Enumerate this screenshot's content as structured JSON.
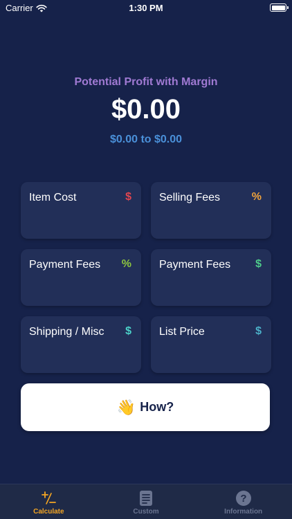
{
  "status_bar": {
    "carrier": "Carrier",
    "time": "1:30 PM"
  },
  "header": {
    "label": "Potential Profit with Margin",
    "value": "$0.00",
    "range": "$0.00 to $0.00"
  },
  "cards": [
    {
      "label": "Item Cost",
      "unit": "$",
      "unit_color": "#e0454f"
    },
    {
      "label": "Selling Fees",
      "unit": "%",
      "unit_color": "#f0a33c"
    },
    {
      "label": "Payment Fees",
      "unit": "%",
      "unit_color": "#8dc63f"
    },
    {
      "label": "Payment Fees",
      "unit": "$",
      "unit_color": "#4ecb8a"
    },
    {
      "label": "Shipping / Misc",
      "unit": "$",
      "unit_color": "#4bd1c8"
    },
    {
      "label": "List Price",
      "unit": "$",
      "unit_color": "#4bb0c8"
    }
  ],
  "how_button": {
    "emoji": "👋",
    "label": "How?"
  },
  "tabs": [
    {
      "label": "Calculate",
      "icon": "plus-minus-icon",
      "active": true
    },
    {
      "label": "Custom",
      "icon": "document-icon",
      "active": false
    },
    {
      "label": "Information",
      "icon": "question-icon",
      "active": false
    }
  ],
  "colors": {
    "background": "#16224a",
    "card": "#222f58",
    "accent_purple": "#a07ad3",
    "accent_blue": "#4a90d9",
    "tab_active": "#f5a623",
    "tab_inactive": "#6b7591"
  }
}
